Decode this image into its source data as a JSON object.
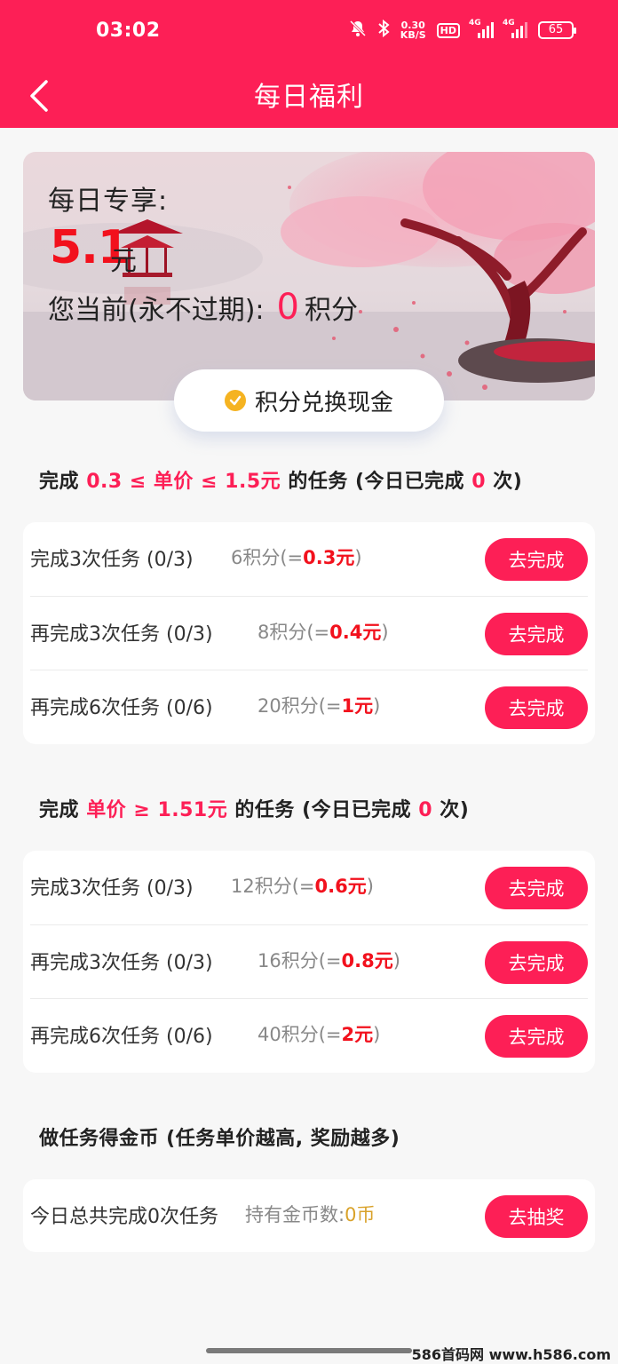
{
  "status_bar": {
    "time": "03:02",
    "net_speed_value": "0.30",
    "net_speed_unit": "KB/S",
    "hd_label": "HD",
    "signal_1": "4G",
    "signal_2": "4G",
    "battery": "65"
  },
  "header": {
    "title": "每日福利"
  },
  "banner": {
    "title": "每日专享:",
    "amount": "5.1",
    "amount_unit": "元",
    "points_prefix": "您当前(永不过期):",
    "points_value": "0",
    "points_suffix": "积分"
  },
  "exchange_button": {
    "label": "积分兑换现金"
  },
  "section1": {
    "prefix": "完成",
    "range": "0.3 ≤ 单价 ≤ 1.5元",
    "middle": "的任务 (今日已完成",
    "count": "0",
    "suffix": "次)",
    "tasks": [
      {
        "name": "完成3次任务 (0/3)",
        "points": "6积分(=",
        "cash": "0.3元",
        "close": ")",
        "button": "去完成"
      },
      {
        "name": "再完成3次任务 (0/3)",
        "points": "8积分(=",
        "cash": "0.4元",
        "close": ")",
        "button": "去完成"
      },
      {
        "name": "再完成6次任务 (0/6)",
        "points": "20积分(=",
        "cash": "1元",
        "close": ")",
        "button": "去完成"
      }
    ]
  },
  "section2": {
    "prefix": "完成",
    "range": "单价 ≥ 1.51元",
    "middle": "的任务 (今日已完成",
    "count": "0",
    "suffix": "次)",
    "tasks": [
      {
        "name": "完成3次任务 (0/3)",
        "points": "12积分(=",
        "cash": "0.6元",
        "close": ")",
        "button": "去完成"
      },
      {
        "name": "再完成3次任务 (0/3)",
        "points": "16积分(=",
        "cash": "0.8元",
        "close": ")",
        "button": "去完成"
      },
      {
        "name": "再完成6次任务 (0/6)",
        "points": "40积分(=",
        "cash": "2元",
        "close": ")",
        "button": "去完成"
      }
    ]
  },
  "section3": {
    "heading": "做任务得金币 (任务单价越高, 奖励越多)",
    "total_text": "今日总共完成0次任务",
    "coins_label": "持有金币数:",
    "coins_value": "0币",
    "button": "去抽奖"
  },
  "watermark": "586首码网 www.h586.com",
  "colors": {
    "brand": "#fd1f56",
    "cash_red": "#f2111d",
    "gold": "#d9a22a",
    "page_bg": "#f7f7f7"
  },
  "icons": [
    "back-arrow-icon",
    "mute-bell-icon",
    "bluetooth-icon",
    "check-circle-icon"
  ]
}
